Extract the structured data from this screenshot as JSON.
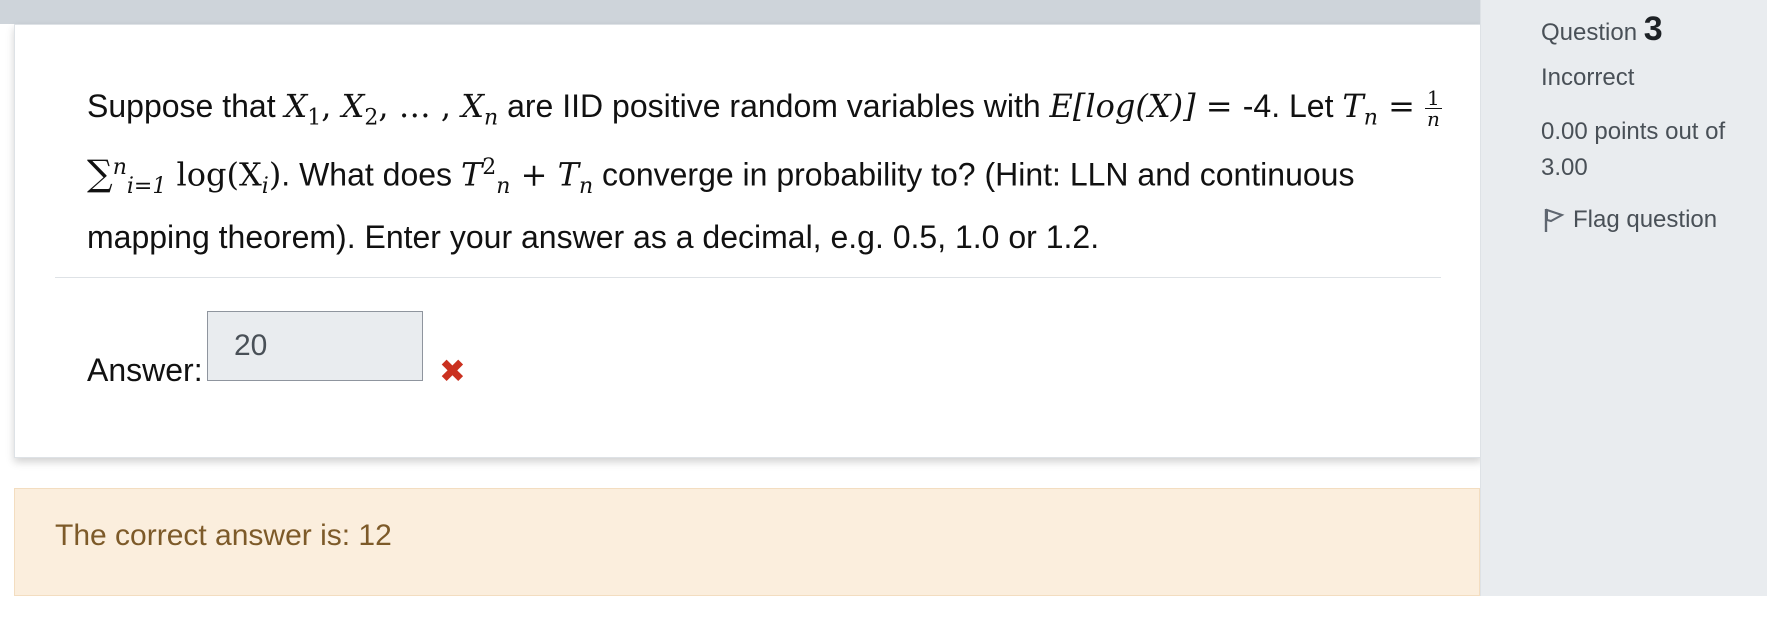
{
  "question": {
    "text_part1": "Suppose that ",
    "x1": "X",
    "sub1": "1",
    "x2": "X",
    "sub2": "2",
    "ellipsis": "…",
    "xn": "X",
    "subn": "n",
    "text_part2": " are IID positive random variables with ",
    "expectation": "E[log(X)]",
    "equals": " = ",
    "value": "-4",
    "text_part3": ". Let ",
    "tn": "T",
    "tn_sub": "n",
    "frac_num": "1",
    "frac_den": "n",
    "sum": "∑",
    "sum_top": "n",
    "sum_bottom": "i=1",
    "log_term": " log(X",
    "log_sub": "i",
    "log_close": ")",
    "text_part4": ". What does ",
    "tn2": "T",
    "tn2_sub": "n",
    "tn2_sup": "2",
    "plus": " + ",
    "tn3": "T",
    "tn3_sub": "n",
    "text_part5": " converge in probability to? (Hint: LLN and continuous mapping theorem). Enter your answer as a decimal, e.g. 0.5, 1.0 or 1.2."
  },
  "answer": {
    "label": "Answer:",
    "value": "20",
    "status_icon": "cross-icon"
  },
  "feedback": {
    "text": "The correct answer is: 12"
  },
  "info": {
    "question_label": "Question",
    "question_number": "3",
    "state": "Incorrect",
    "grade": "0.00 points out of 3.00",
    "flag_label": "Flag question",
    "flag_icon": "flag-icon"
  },
  "colors": {
    "incorrect": "#ca3120",
    "feedback_bg": "#fbeedd",
    "feedback_text": "#7d5a29",
    "sidebar_bg": "#e9ecef"
  }
}
